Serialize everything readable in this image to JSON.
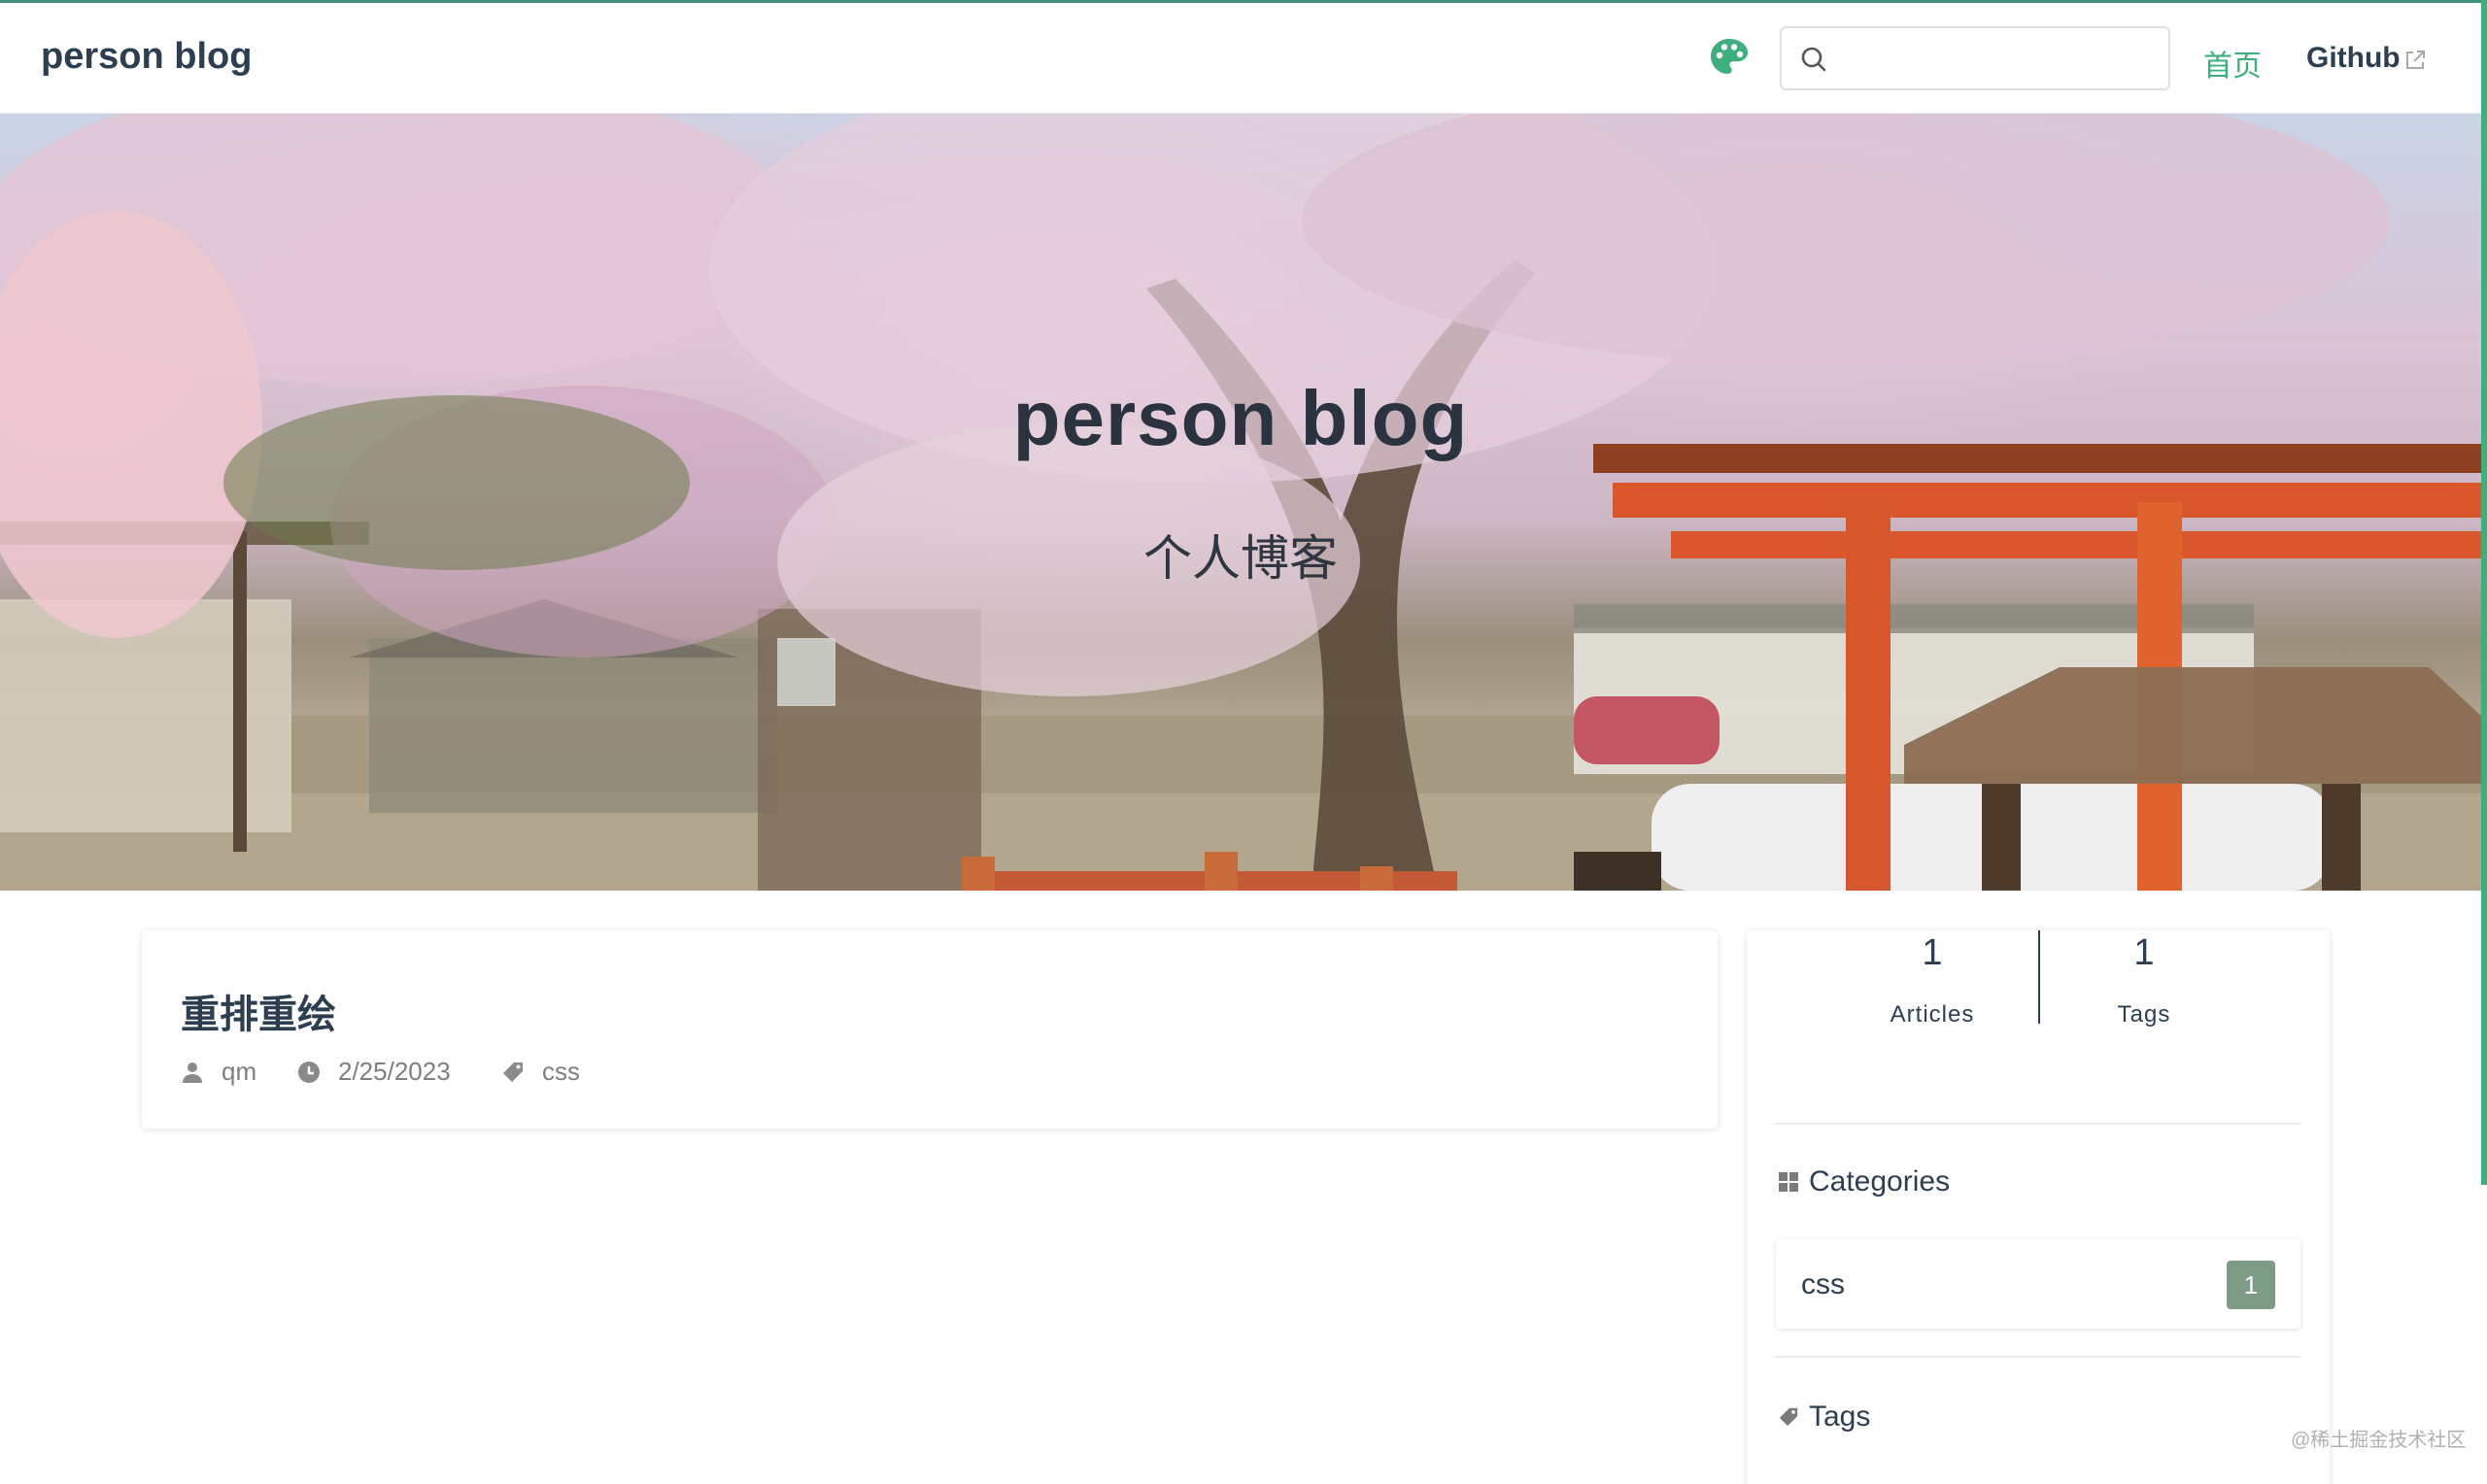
{
  "navbar": {
    "site_name": "person blog",
    "search_value": "",
    "links": [
      {
        "label": "首页",
        "active": true
      },
      {
        "label": "Github",
        "external": true
      }
    ],
    "palette_icon": "palette-icon",
    "search_icon": "search-icon",
    "accent_color": "#3eaf7c"
  },
  "hero": {
    "title": "person blog",
    "subtitle": "个人博客"
  },
  "articles": [
    {
      "title": "重排重绘",
      "author": "qm",
      "date": "2/25/2023",
      "tag": "css"
    }
  ],
  "sidebar": {
    "stats": [
      {
        "value": "1",
        "label": "Articles"
      },
      {
        "value": "1",
        "label": "Tags"
      }
    ],
    "categories_title": "Categories",
    "categories": [
      {
        "name": "css",
        "count": "1"
      }
    ],
    "tags_title": "Tags"
  },
  "watermark": "@稀土掘金技术社区"
}
